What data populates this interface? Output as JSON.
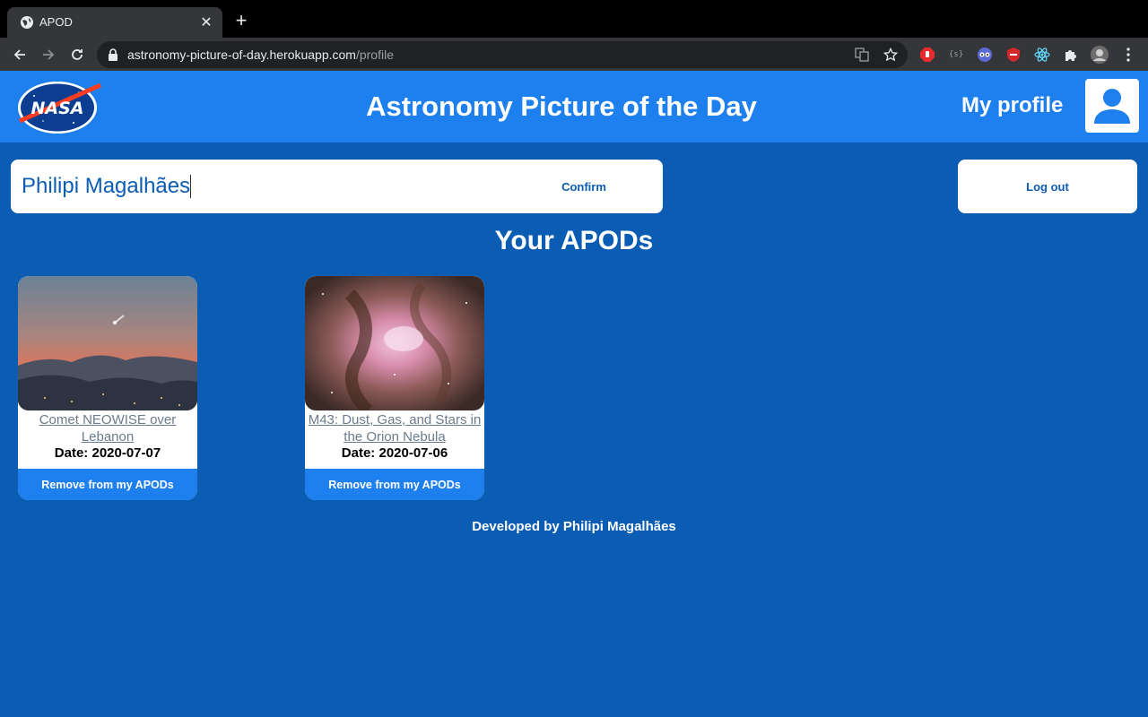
{
  "browser": {
    "tab_title": "APOD",
    "url_host": "astronomy-picture-of-day.herokuapp.com",
    "url_path": "/profile"
  },
  "header": {
    "logo_text": "NASA",
    "title": "Astronomy Picture of the Day",
    "profile_label": "My profile"
  },
  "profile": {
    "name_value": "Philipi Magalhães",
    "confirm_label": "Confirm",
    "logout_label": "Log out"
  },
  "apods": {
    "title": "Your APODs",
    "items": [
      {
        "title_line1": "Comet NEOWISE over",
        "title_line2": "Lebanon",
        "date": "Date: 2020-07-07",
        "remove_label": "Remove from my APODs"
      },
      {
        "title_line1": "M43: Dust, Gas, and Stars in",
        "title_line2": "the Orion Nebula",
        "date": "Date: 2020-07-06",
        "remove_label": "Remove from my APODs"
      }
    ]
  },
  "footer": {
    "text": "Developed by Philipi Magalhães"
  },
  "colors": {
    "page_bg": "#0b5cb3",
    "header_bg": "#1e7fee",
    "button_bg": "#1e7fee"
  }
}
